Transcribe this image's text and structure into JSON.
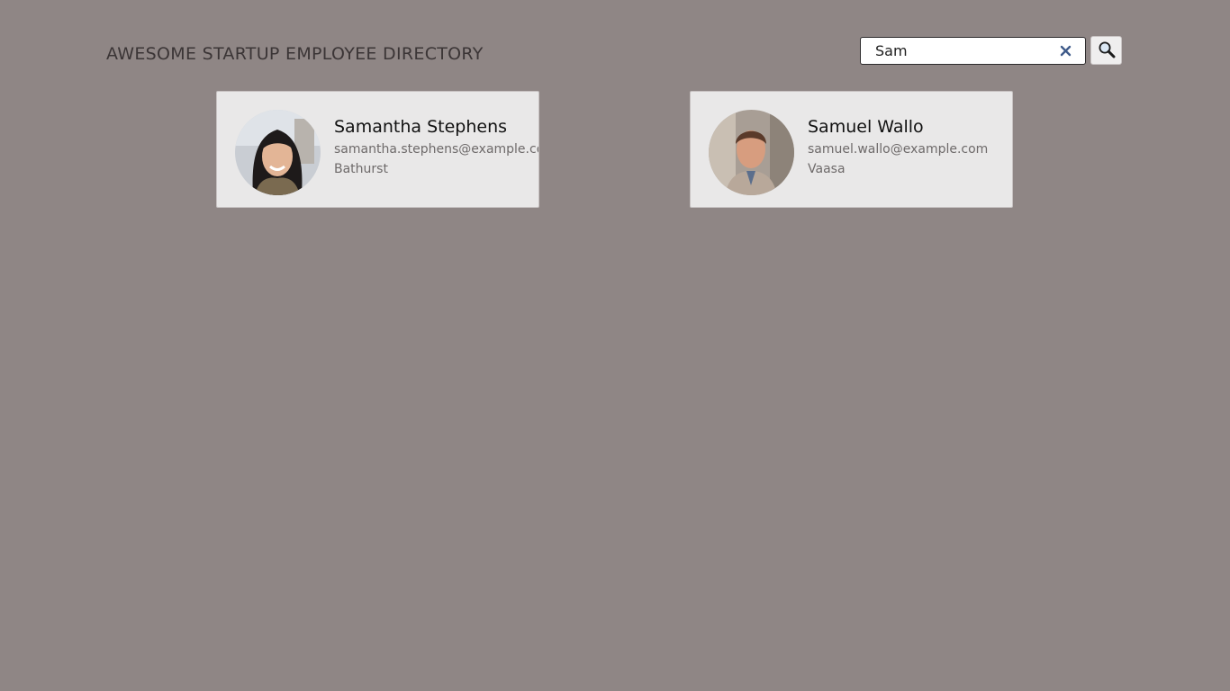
{
  "header": {
    "title": "AWESOME STARTUP EMPLOYEE DIRECTORY"
  },
  "search": {
    "value": "Sam",
    "clear_icon": "close-icon",
    "submit_icon": "search-icon"
  },
  "employees": [
    {
      "name": "Samantha Stephens",
      "email": "samantha.stephens@example.com",
      "city": "Bathurst",
      "avatar": "photo-woman"
    },
    {
      "name": "Samuel Wallo",
      "email": "samuel.wallo@example.com",
      "city": "Vaasa",
      "avatar": "photo-man"
    }
  ],
  "colors": {
    "background": "#8f8685",
    "card": "#e9e8e8",
    "title": "#3b3536",
    "clear_icon": "#3f5b8a"
  }
}
